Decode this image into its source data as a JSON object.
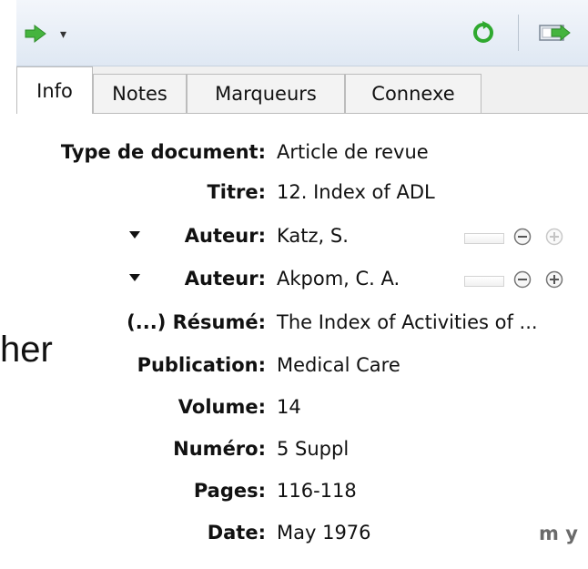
{
  "outer": {
    "partial_text": "her"
  },
  "tabs": [
    {
      "label": "Info",
      "active": true
    },
    {
      "label": "Notes",
      "active": false
    },
    {
      "label": "Marqueurs",
      "active": false
    },
    {
      "label": "Connexe",
      "active": false
    }
  ],
  "fields": {
    "type_label": "Type de document:",
    "type_value": "Article de revue",
    "title_label": "Titre:",
    "title_value": "12. Index of ADL",
    "author1_label": "Auteur:",
    "author1_value": "Katz, S.",
    "author2_label": "Auteur:",
    "author2_value": "Akpom, C. A.",
    "abstract_label": "(...) Résumé:",
    "abstract_value": "The Index of Activities of ...",
    "publication_label": "Publication:",
    "publication_value": "Medical Care",
    "volume_label": "Volume:",
    "volume_value": "14",
    "issue_label": "Numéro:",
    "issue_value": "5 Suppl",
    "pages_label": "Pages:",
    "pages_value": "116-118",
    "date_label": "Date:",
    "date_value": "May 1976",
    "date_mode": "m y"
  },
  "colors": {
    "accent_green": "#2fa92f",
    "toolbar_top": "#f3f6fb",
    "toolbar_bottom": "#dfe8f3"
  },
  "icons": [
    "green-arrow-icon",
    "caret-down-icon",
    "sync-icon",
    "export-icon",
    "minus-circle-icon",
    "plus-circle-icon"
  ]
}
